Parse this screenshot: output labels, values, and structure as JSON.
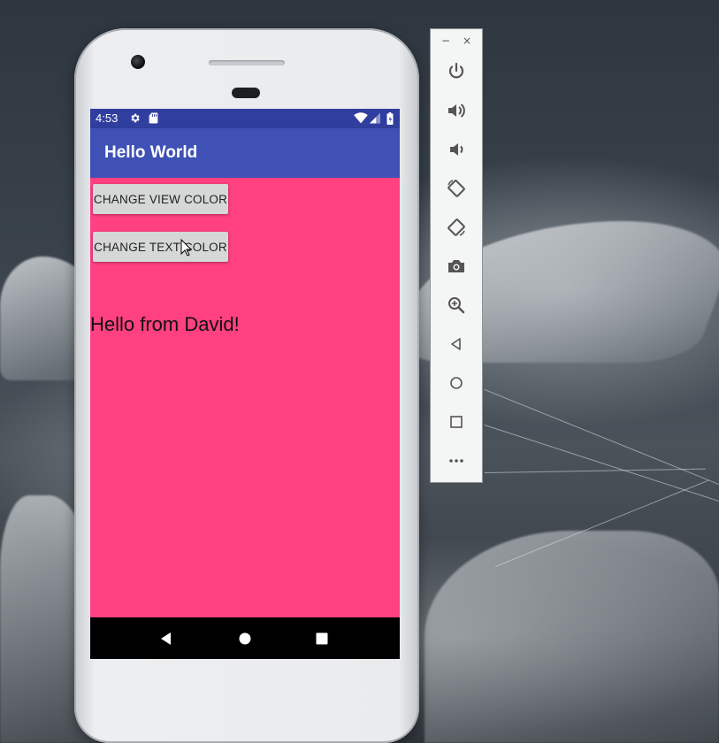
{
  "statusbar": {
    "time": "4:53",
    "icons": [
      "gear-icon",
      "sd-card-icon",
      "wifi-icon",
      "signal-icon",
      "battery-icon"
    ]
  },
  "app": {
    "title": "Hello World",
    "background_color": "#ff4081",
    "appbar_color": "#3f51b5",
    "statusbar_color": "#303f9f"
  },
  "buttons": {
    "change_view_color": "CHANGE VIEW COLOR",
    "change_text_color": "CHANGE TEXT COLOR"
  },
  "message": "Hello from David!",
  "navbar": {
    "buttons": [
      "back-icon",
      "home-icon",
      "recents-icon"
    ]
  },
  "emulator_toolbar": {
    "minimize": "−",
    "close": "×",
    "buttons": [
      "power-icon",
      "volume-up-icon",
      "volume-down-icon",
      "rotate-left-icon",
      "rotate-right-icon",
      "camera-icon",
      "zoom-icon",
      "back-icon",
      "home-icon",
      "overview-icon",
      "more-icon"
    ]
  }
}
